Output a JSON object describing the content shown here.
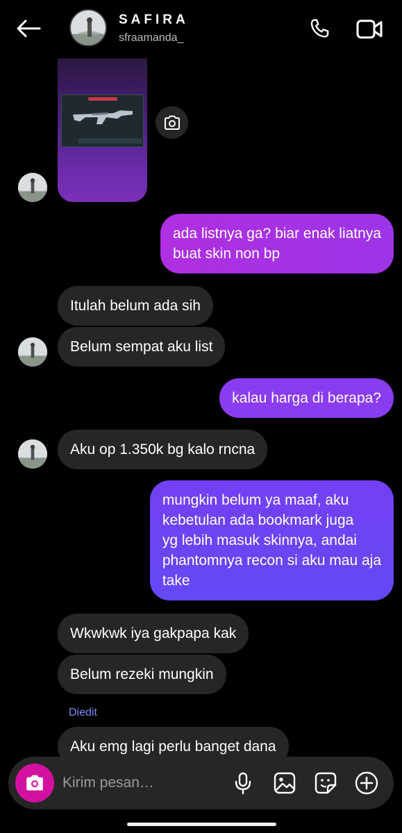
{
  "header": {
    "name": "SAFIRA",
    "username": "sfraamanda_"
  },
  "messages": [
    {
      "side": "out",
      "text": "ada listnya ga? biar enak liatnya\nbuat skin non bp"
    },
    {
      "side": "in",
      "text": "Itulah belum ada sih"
    },
    {
      "side": "in",
      "text": "Belum sempat aku list"
    },
    {
      "side": "out",
      "text": "kalau harga di berapa?"
    },
    {
      "side": "in",
      "text": "Aku op 1.350k bg kalo rncna"
    },
    {
      "side": "out",
      "text": "mungkin belum ya maaf, aku\nkebetulan ada bookmark juga\nyg lebih masuk skinnya, andai\nphantomnya recon si aku mau aja\ntake"
    },
    {
      "side": "in",
      "text": "Wkwkwk iya gakpapa kak"
    },
    {
      "side": "in",
      "text": "Belum rezeki mungkin"
    },
    {
      "side": "in",
      "text": "Aku emg lagi perlu banget dana"
    }
  ],
  "edited_label": "Diedit",
  "composer": {
    "placeholder": "Kirim pesan…"
  },
  "colors": {
    "bubble_in": "#262626",
    "bubble_out_pink": "#b52fe0",
    "bubble_out_purple": "#8a3cf0",
    "bubble_out_violet": "#6a45f5",
    "camera_button": "#d3109f",
    "edited_label": "#7c8cff"
  },
  "icons": [
    "back-arrow-icon",
    "phone-icon",
    "video-call-icon",
    "camera-icon",
    "microphone-icon",
    "gallery-icon",
    "sticker-icon",
    "add-icon"
  ]
}
